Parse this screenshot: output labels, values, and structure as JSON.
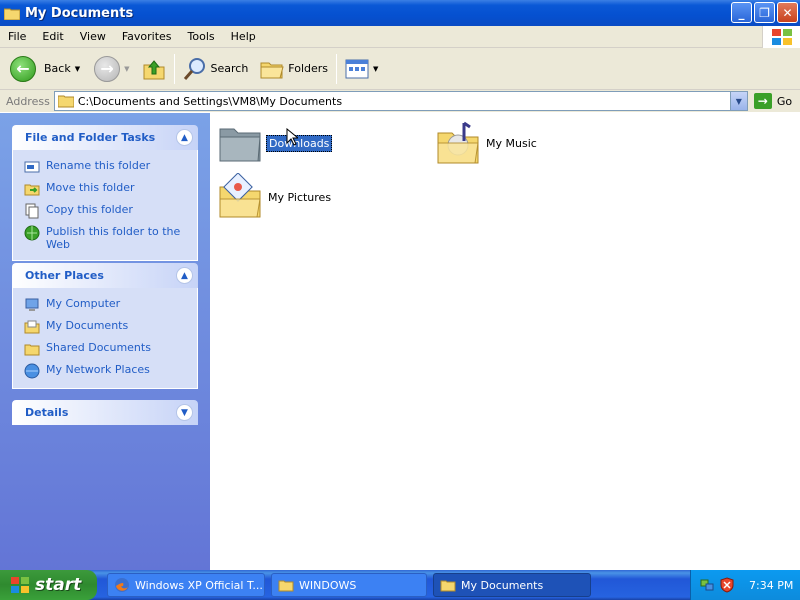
{
  "window": {
    "title": "My Documents",
    "buttons": {
      "minimize": "_",
      "maximize": "❐",
      "close": "✕"
    }
  },
  "menu": [
    "File",
    "Edit",
    "View",
    "Favorites",
    "Tools",
    "Help"
  ],
  "toolbar": {
    "back_label": "Back",
    "search_label": "Search",
    "folders_label": "Folders"
  },
  "address": {
    "label": "Address",
    "value": "C:\\Documents and Settings\\VM8\\My Documents",
    "go_label": "Go"
  },
  "taskpane": {
    "file_tasks": {
      "title": "File and Folder Tasks",
      "items": [
        {
          "label": "Rename this folder",
          "icon": "rename-icon"
        },
        {
          "label": "Move this folder",
          "icon": "move-icon"
        },
        {
          "label": "Copy this folder",
          "icon": "copy-icon"
        },
        {
          "label": "Publish this folder to the Web",
          "icon": "publish-web-icon"
        }
      ]
    },
    "other_places": {
      "title": "Other Places",
      "items": [
        {
          "label": "My Computer",
          "icon": "computer-icon"
        },
        {
          "label": "My Documents",
          "icon": "documents-icon"
        },
        {
          "label": "Shared Documents",
          "icon": "folder-icon"
        },
        {
          "label": "My Network Places",
          "icon": "network-icon"
        }
      ]
    },
    "details": {
      "title": "Details"
    }
  },
  "content": {
    "items": [
      {
        "label": "Downloads",
        "icon": "folder-gray-icon",
        "selected": true
      },
      {
        "label": "My Music",
        "icon": "music-folder-icon",
        "selected": false
      },
      {
        "label": "My Pictures",
        "icon": "pictures-folder-icon",
        "selected": false
      }
    ]
  },
  "taskbar": {
    "start_label": "start",
    "buttons": [
      {
        "label": "Windows XP Official T...",
        "icon": "firefox-icon",
        "active": false
      },
      {
        "label": "WINDOWS",
        "icon": "folder-icon",
        "active": false
      },
      {
        "label": "My Documents",
        "icon": "folder-icon",
        "active": true
      }
    ],
    "clock": "7:34 PM"
  },
  "colors": {
    "titlebar": "#0a58d6",
    "taskpane_link": "#215dc6",
    "selection": "#316ac5",
    "start_green": "#3c9a3c"
  }
}
